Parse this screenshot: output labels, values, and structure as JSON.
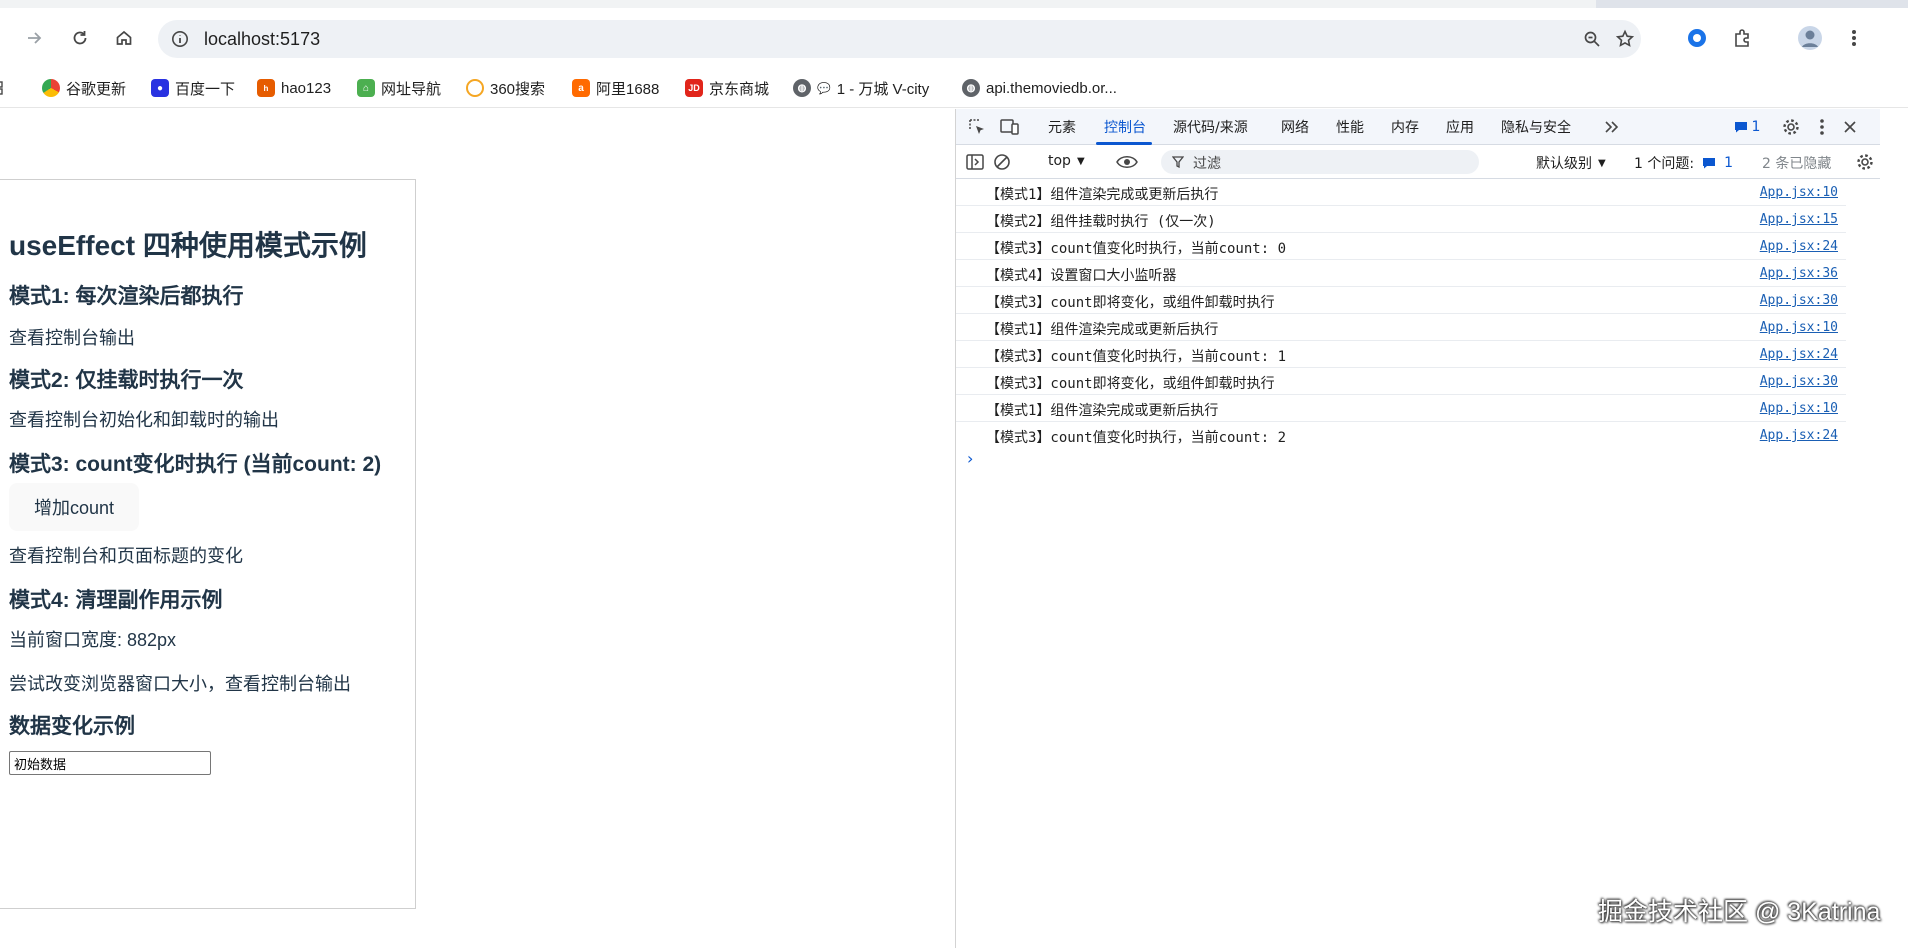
{
  "browser": {
    "url": "localhost:5173",
    "bookmarks": [
      {
        "label": "谷歌更新",
        "color": "#4285f4"
      },
      {
        "label": "百度一下",
        "color": "#2932e1"
      },
      {
        "label": "hao123",
        "color": "#e65c00"
      },
      {
        "label": "网址导航",
        "color": "#4caf50"
      },
      {
        "label": "360搜索",
        "color": "#f5a623"
      },
      {
        "label": "阿里1688",
        "color": "#ff6a00"
      },
      {
        "label": "京东商城",
        "color": "#e1251b"
      },
      {
        "label": "1 - 万城 V-city",
        "color": "#5f6368"
      },
      {
        "label": "api.themoviedb.or...",
        "color": "#5f6368"
      }
    ]
  },
  "page": {
    "title": "useEffect 四种使用模式示例",
    "mode1": {
      "heading": "模式1: 每次渲染后都执行",
      "text": "查看控制台输出"
    },
    "mode2": {
      "heading": "模式2: 仅挂载时执行一次",
      "text": "查看控制台初始化和卸载时的输出"
    },
    "mode3": {
      "heading": "模式3: count变化时执行 (当前count: 2)",
      "button": "增加count",
      "text": "查看控制台和页面标题的变化"
    },
    "mode4": {
      "heading": "模式4: 清理副作用示例",
      "width_text": "当前窗口宽度: 882px",
      "text": "尝试改变浏览器窗口大小，查看控制台输出"
    },
    "data_example": {
      "heading": "数据变化示例",
      "input_value": "初始数据"
    }
  },
  "devtools": {
    "tabs": [
      "元素",
      "控制台",
      "源代码/来源",
      "网络",
      "性能",
      "内存",
      "应用",
      "隐私与安全"
    ],
    "active_tab": "控制台",
    "issues_badge": "1",
    "context": "top",
    "filter_placeholder": "过滤",
    "level": "默认级别",
    "issues_text": "1 个问题:",
    "issues_count": "1",
    "hidden_text": "2 条已隐藏",
    "logs": [
      {
        "msg": "【模式1】组件渲染完成或更新后执行",
        "src": "App.jsx:10"
      },
      {
        "msg": "【模式2】组件挂载时执行 (仅一次)",
        "src": "App.jsx:15"
      },
      {
        "msg": "【模式3】count值变化时执行，当前count: 0",
        "src": "App.jsx:24"
      },
      {
        "msg": "【模式4】设置窗口大小监听器",
        "src": "App.jsx:36"
      },
      {
        "msg": "【模式3】count即将变化，或组件卸载时执行",
        "src": "App.jsx:30"
      },
      {
        "msg": "【模式1】组件渲染完成或更新后执行",
        "src": "App.jsx:10"
      },
      {
        "msg": "【模式3】count值变化时执行，当前count: 1",
        "src": "App.jsx:24"
      },
      {
        "msg": "【模式3】count即将变化，或组件卸载时执行",
        "src": "App.jsx:30"
      },
      {
        "msg": "【模式1】组件渲染完成或更新后执行",
        "src": "App.jsx:10"
      },
      {
        "msg": "【模式3】count值变化时执行，当前count: 2",
        "src": "App.jsx:24"
      }
    ]
  },
  "watermark": "掘金技术社区 @ 3Katrina"
}
